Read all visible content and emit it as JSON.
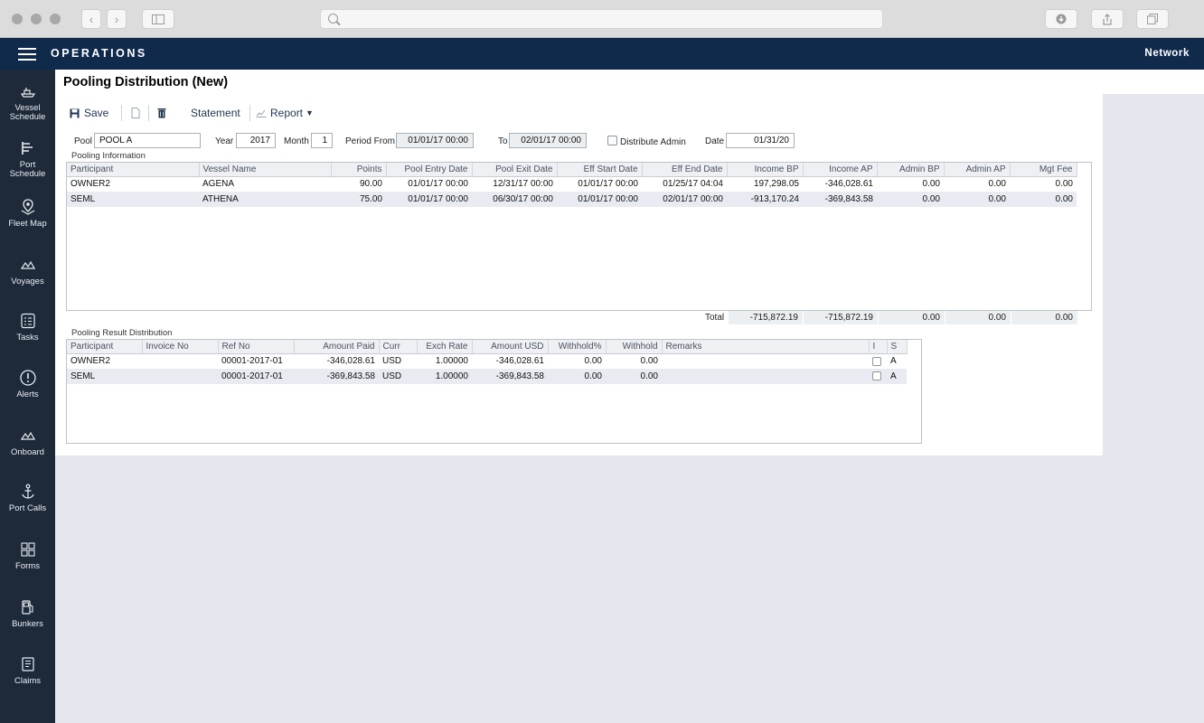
{
  "header": {
    "app_title": "OPERATIONS",
    "network_label": "Network"
  },
  "sidebar": {
    "items": [
      {
        "label1": "Vessel",
        "label2": "Schedule",
        "icon": "ship-icon"
      },
      {
        "label1": "Port",
        "label2": "Schedule",
        "icon": "calendar-gantt-icon"
      },
      {
        "label1": "Fleet Map",
        "label2": "",
        "icon": "map-pin-icon"
      },
      {
        "label1": "Voyages",
        "label2": "",
        "icon": "voyages-icon"
      },
      {
        "label1": "Tasks",
        "label2": "",
        "icon": "tasks-icon"
      },
      {
        "label1": "Alerts",
        "label2": "",
        "icon": "alert-icon"
      },
      {
        "label1": "Onboard",
        "label2": "",
        "icon": "onboard-icon"
      },
      {
        "label1": "Port Calls",
        "label2": "",
        "icon": "anchor-icon"
      },
      {
        "label1": "Forms",
        "label2": "",
        "icon": "forms-icon"
      },
      {
        "label1": "Bunkers",
        "label2": "",
        "icon": "fuel-icon"
      },
      {
        "label1": "Claims",
        "label2": "",
        "icon": "claims-icon"
      }
    ]
  },
  "page": {
    "title": "Pooling Distribution (New)"
  },
  "toolbar": {
    "save": "Save",
    "statement": "Statement",
    "report": "Report"
  },
  "form": {
    "pool_label": "Pool",
    "pool_value": "POOL A",
    "year_label": "Year",
    "year_value": "2017",
    "month_label": "Month",
    "month_value": "1",
    "period_from_label": "Period From",
    "period_from_value": "01/01/17 00:00",
    "to_label": "To",
    "to_value": "02/01/17 00:00",
    "distribute_admin_label": "Distribute Admin",
    "date_label": "Date",
    "date_value": "01/31/20"
  },
  "pooling_info": {
    "section_label": "Pooling Information",
    "columns": [
      "Participant",
      "Vessel Name",
      "Points",
      "Pool Entry Date",
      "Pool Exit Date",
      "Eff Start Date",
      "Eff End Date",
      "Income BP",
      "Income AP",
      "Admin BP",
      "Admin AP",
      "Mgt Fee"
    ],
    "rows": [
      [
        "OWNER2",
        "AGENA",
        "90.00",
        "01/01/17 00:00",
        "12/31/17 00:00",
        "01/01/17 00:00",
        "01/25/17 04:04",
        "197,298.05",
        "-346,028.61",
        "0.00",
        "0.00",
        "0.00"
      ],
      [
        "SEML",
        "ATHENA",
        "75.00",
        "01/01/17 00:00",
        "06/30/17 00:00",
        "01/01/17 00:00",
        "02/01/17 00:00",
        "-913,170.24",
        "-369,843.58",
        "0.00",
        "0.00",
        "0.00"
      ]
    ],
    "total_label": "Total",
    "totals": [
      "-715,872.19",
      "-715,872.19",
      "0.00",
      "0.00",
      "0.00"
    ]
  },
  "result_distribution": {
    "section_label": "Pooling Result Distribution",
    "columns": [
      "Participant",
      "Invoice No",
      "Ref No",
      "Amount Paid",
      "Curr",
      "Exch Rate",
      "Amount USD",
      "Withhold%",
      "Withhold",
      "Remarks",
      "I",
      "S"
    ],
    "rows": [
      [
        "OWNER2",
        "",
        "00001-2017-01",
        "-346,028.61",
        "USD",
        "1.00000",
        "-346,028.61",
        "0.00",
        "0.00",
        "",
        "",
        "A"
      ],
      [
        "SEML",
        "",
        "00001-2017-01",
        "-369,843.58",
        "USD",
        "1.00000",
        "-369,843.58",
        "0.00",
        "0.00",
        "",
        "",
        "A"
      ]
    ]
  },
  "colors": {
    "header_bg": "#102a4c",
    "sidebar_bg": "#1e2a3a",
    "row_alt": "#e9ebf2"
  }
}
